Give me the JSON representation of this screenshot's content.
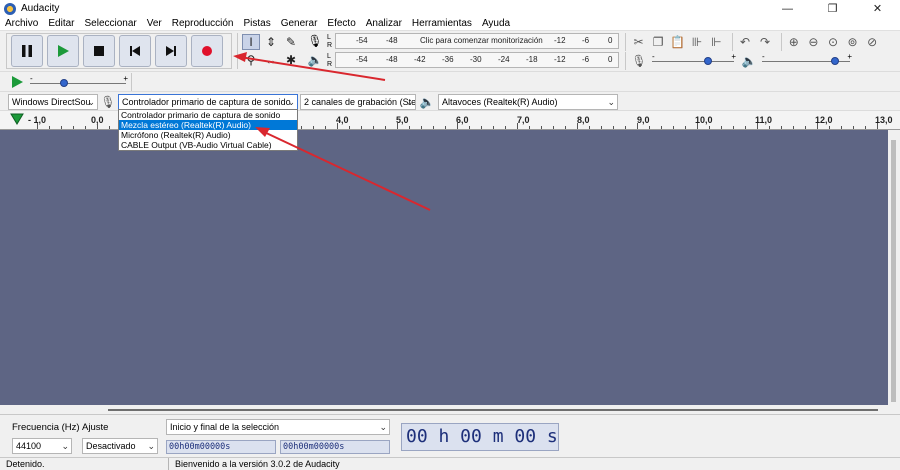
{
  "window": {
    "title": "Audacity",
    "minimize": "—",
    "maximize": "❐",
    "close": "✕"
  },
  "menu": [
    "Archivo",
    "Editar",
    "Seleccionar",
    "Ver",
    "Reproducción",
    "Pistas",
    "Generar",
    "Efecto",
    "Analizar",
    "Herramientas",
    "Ayuda"
  ],
  "meters": {
    "record_ticks": [
      "-54",
      "-48",
      "-12",
      "-6",
      "0"
    ],
    "record_prompt": "Clic para comenzar monitorización",
    "play_ticks": [
      "-54",
      "-48",
      "-42",
      "-36",
      "-30",
      "-24",
      "-18",
      "-12",
      "-6",
      "0"
    ],
    "left_channel": "L",
    "right_channel": "R"
  },
  "sliders": {
    "plus": "+",
    "minus": "-",
    "play_at_speed_level": 0.35,
    "recording_volume_level": 0.72,
    "playback_volume_level": 0.88
  },
  "devices": {
    "host": "Windows DirectSou",
    "recording_device": "Controlador primario de captura de sonido",
    "channels": "2 canales de grabación (Ster",
    "playback_device": "Altavoces (Realtek(R) Audio)"
  },
  "dropdown_options": [
    "Controlador primario de captura de sonido",
    "Mezcla estéreo (Realtek(R) Audio)",
    "Micrófono (Realtek(R) Audio)",
    "CABLE Output (VB-Audio Virtual Cable)"
  ],
  "dropdown_selected_index": 1,
  "ruler": [
    "- 1,0",
    "0,0",
    "4,0",
    "5,0",
    "6,0",
    "7,0",
    "8,0",
    "9,0",
    "10,0",
    "11,0",
    "12,0",
    "13,0"
  ],
  "selection_toolbar": {
    "rate_label": "Frecuencia (Hz)",
    "rate_value": "44100",
    "snap_label": "Ajuste",
    "snap_value": "Desactivado",
    "selection_mode": "Inicio y final de la selección",
    "start_time": "00h00m00000s",
    "end_time": "00h00m00000s",
    "audio_position": "00 h 00 m 00 s"
  },
  "status": {
    "state": "Detenido.",
    "message": "Bienvenido a la versión 3.0.2 de Audacity"
  },
  "colors": {
    "track_area": "#5e6584",
    "record_red": "#e0102b",
    "play_green": "#1c9a3a",
    "selection_blue": "#0078d7",
    "annotation_red": "#d9272e"
  }
}
